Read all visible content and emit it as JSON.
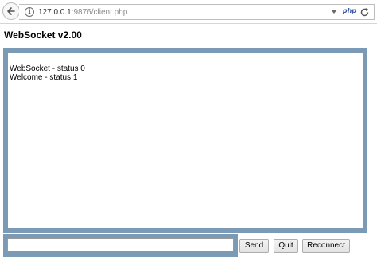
{
  "browser": {
    "url_host": "127.0.0.1",
    "url_rest": ":9876/client.php",
    "php_label": "php"
  },
  "page": {
    "title": "WebSocket v2.00"
  },
  "log": {
    "lines": [
      "WebSocket - status 0",
      "Welcome - status 1"
    ]
  },
  "controls": {
    "message_value": "",
    "send_label": "Send",
    "quit_label": "Quit",
    "reconnect_label": "Reconnect"
  },
  "colors": {
    "frame": "#7b9ab6"
  },
  "icons": [
    "back-arrow-icon",
    "info-icon",
    "dropdown-arrow-icon",
    "php-icon",
    "reload-icon"
  ]
}
